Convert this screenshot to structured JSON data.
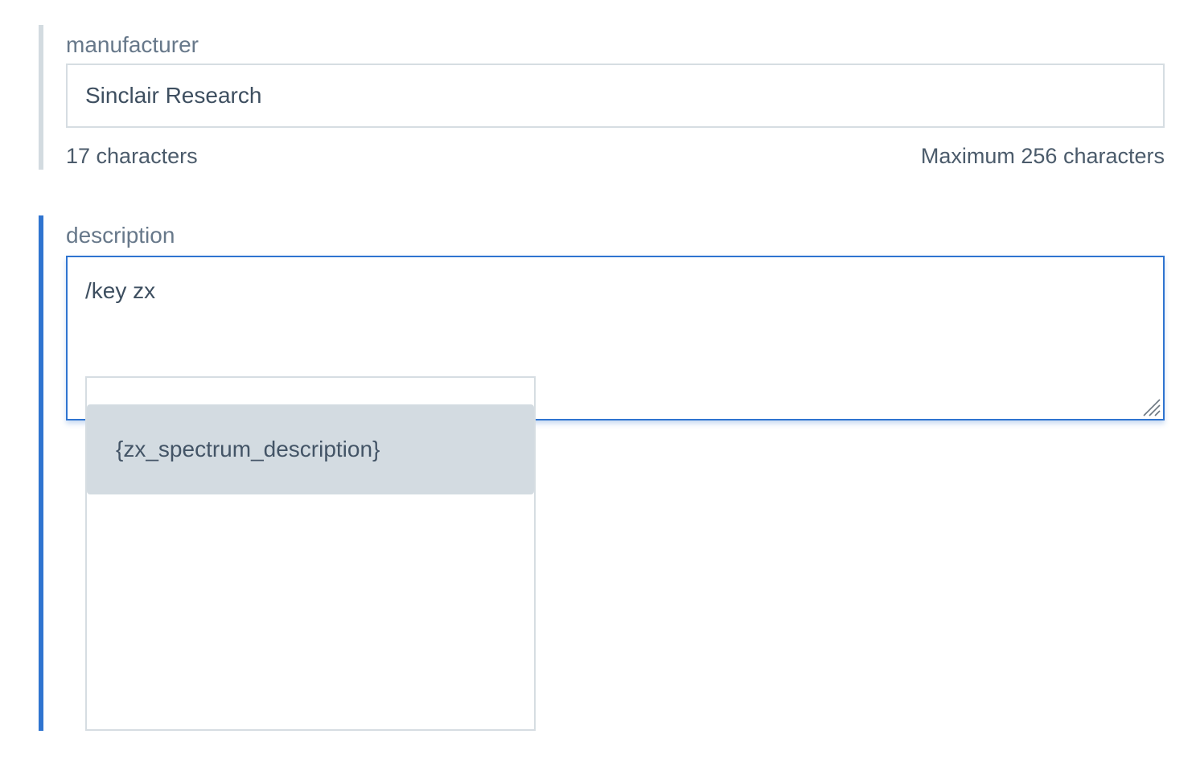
{
  "manufacturer": {
    "label": "manufacturer",
    "value": "Sinclair Research",
    "char_count": "17 characters",
    "max_chars": "Maximum 256 characters"
  },
  "description": {
    "label": "description",
    "value": "/key zx"
  },
  "autocomplete": {
    "items": [
      {
        "label": "{zx_spectrum_description}"
      }
    ]
  },
  "colors": {
    "accent": "#2f74d0",
    "inactive_bar": "#d3dbe0",
    "highlight": "#d3dbe1",
    "text": "#3e4f60",
    "label": "#67788a"
  },
  "icons": {
    "resize": "resize-handle-icon"
  }
}
